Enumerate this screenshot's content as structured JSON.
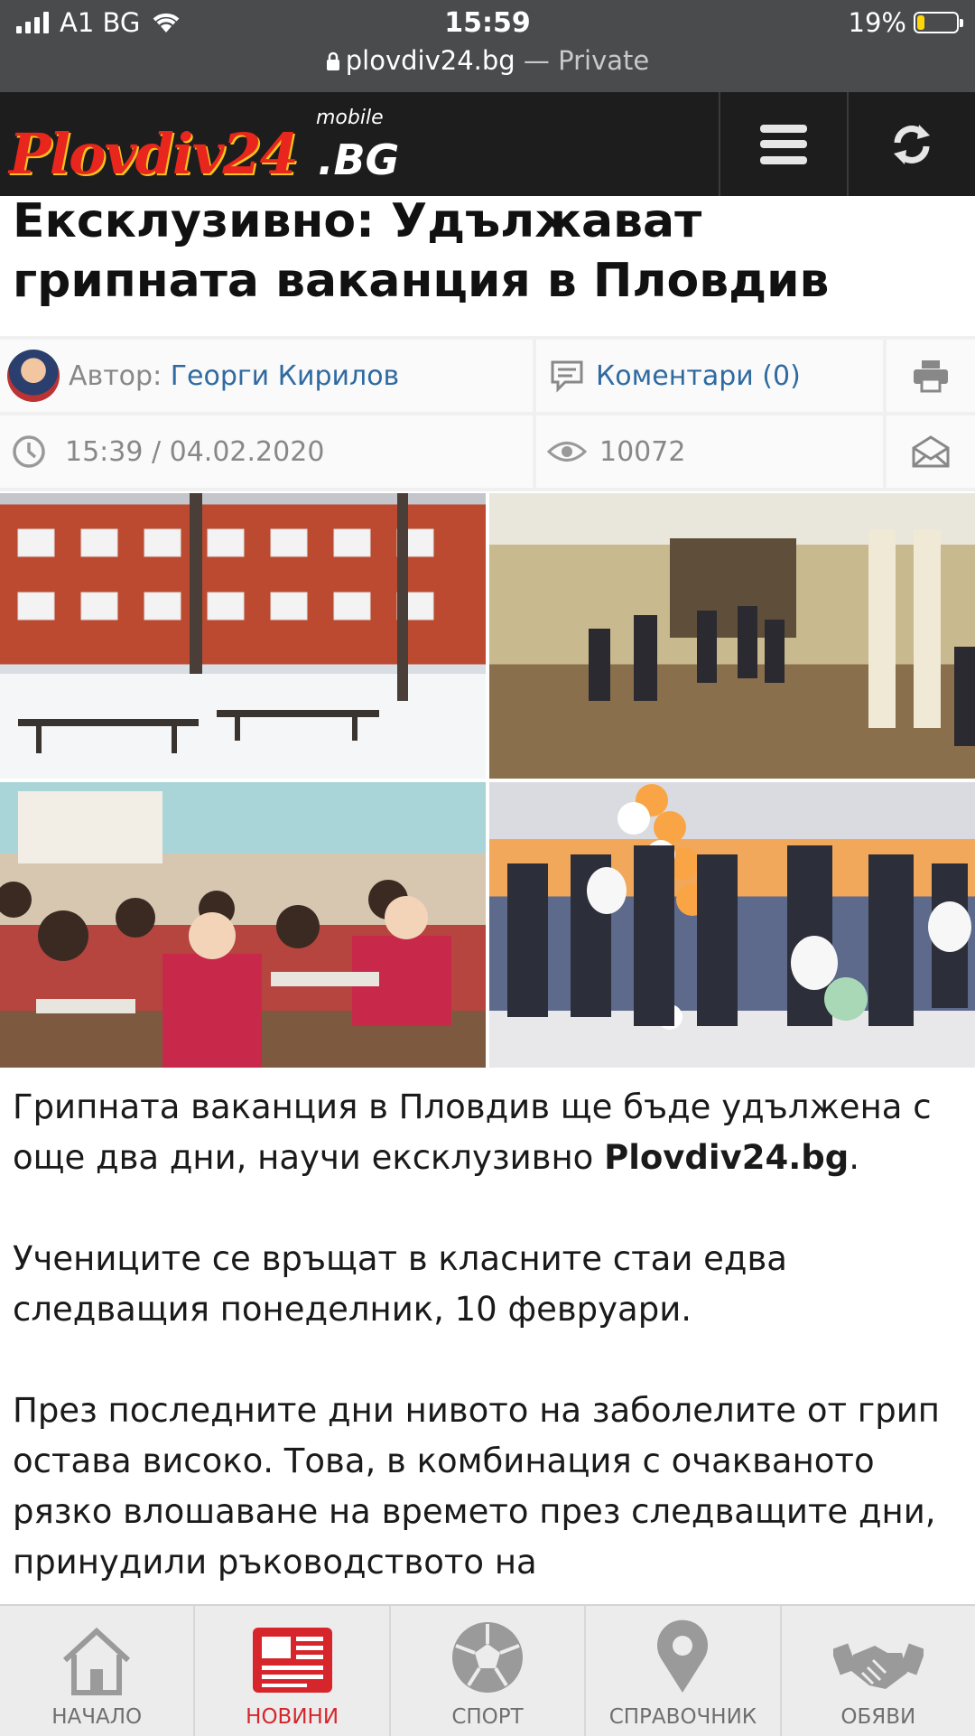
{
  "status": {
    "carrier": "A1 BG",
    "time": "15:59",
    "battery_percent": "19%",
    "battery_level": 0.19,
    "battery_color": "#ffd60a",
    "url": "plovdiv24.bg",
    "url_suffix": " — Private"
  },
  "header": {
    "logo_main": "Plovdiv24",
    "logo_tld": ".BG",
    "logo_mobile": "mobile",
    "menu_icon": "hamburger-icon",
    "refresh_icon": "refresh-icon"
  },
  "article": {
    "title": "Ексклузивно: Удължават грипната ваканция в Пловдив",
    "author_label": "Автор:",
    "author_name": "Георги Кирилов",
    "comments": "Коментари (0)",
    "datetime": "15:39 / 04.02.2020",
    "views": "10072",
    "p1_a": "Грипната ваканция в Пловдив ще бъде удължена с още два дни, научи ексклузивно ",
    "p1_bold": "Plovdiv24.bg",
    "p1_end": ".",
    "p2": "Учениците се връщат в класните стаи едва следващия понеделник, 10 февруари.",
    "p3": "През последните дни нивото на заболелите от грип остава високо. Това, в комбинация с очакваното рязко влошаване на времето през следващите дни, принудили ръководството на"
  },
  "nav": {
    "home": "НАЧАЛО",
    "news": "НОВИНИ",
    "sport": "СПОРТ",
    "directory": "СПРАВОЧНИК",
    "ads": "ОБЯВИ",
    "active_color": "#d7262b"
  }
}
